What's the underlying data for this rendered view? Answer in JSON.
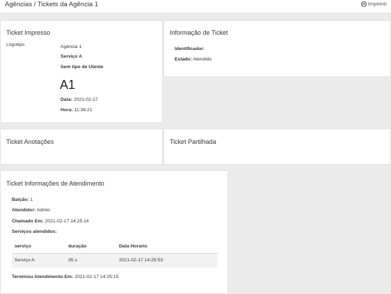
{
  "header": {
    "breadcrumb": "Agências / Tickets da Agência 1",
    "print_label": "Imprimir",
    "print_icon": "printer-icon"
  },
  "ticket_impresso": {
    "title": "Ticket Impresso",
    "logo_label": "Logotipo",
    "agency": "Agência 1",
    "service": "Serviço A",
    "user_type": "Sem tipo de Utente",
    "number": "A1",
    "date_label": "Data:",
    "date_value": "2021-02-17",
    "time_label": "Hora:",
    "time_value": "11:36:21"
  },
  "informacao_ticket": {
    "title": "Informação de Ticket",
    "identifier_label": "Identificador:",
    "identifier_value": "",
    "state_label": "Estado:",
    "state_value": "Atendido"
  },
  "anotacoes": {
    "title": "Ticket Anotações"
  },
  "partilhada": {
    "title": "Ticket Partilhada"
  },
  "atendimento": {
    "title": "Ticket Informações de Atendimento",
    "balcao_label": "Balção:",
    "balcao_value": "1",
    "atendidor_label": "Atendidor:",
    "atendidor_value": "Admin",
    "chamado_label": "Chamado Em:",
    "chamado_value": "2021-02-17 14:25:14",
    "servicos_label": "Serviços atendidos:",
    "table": {
      "columns": [
        "serviço",
        "duração",
        "Data Horario"
      ],
      "rows": [
        [
          "Serviço A",
          "35 s",
          "2021-02-17 14:25:53"
        ]
      ]
    },
    "terminou_label": "Terminou Atendimento Em:",
    "terminou_value": "2021-02-17 14:25:15"
  }
}
